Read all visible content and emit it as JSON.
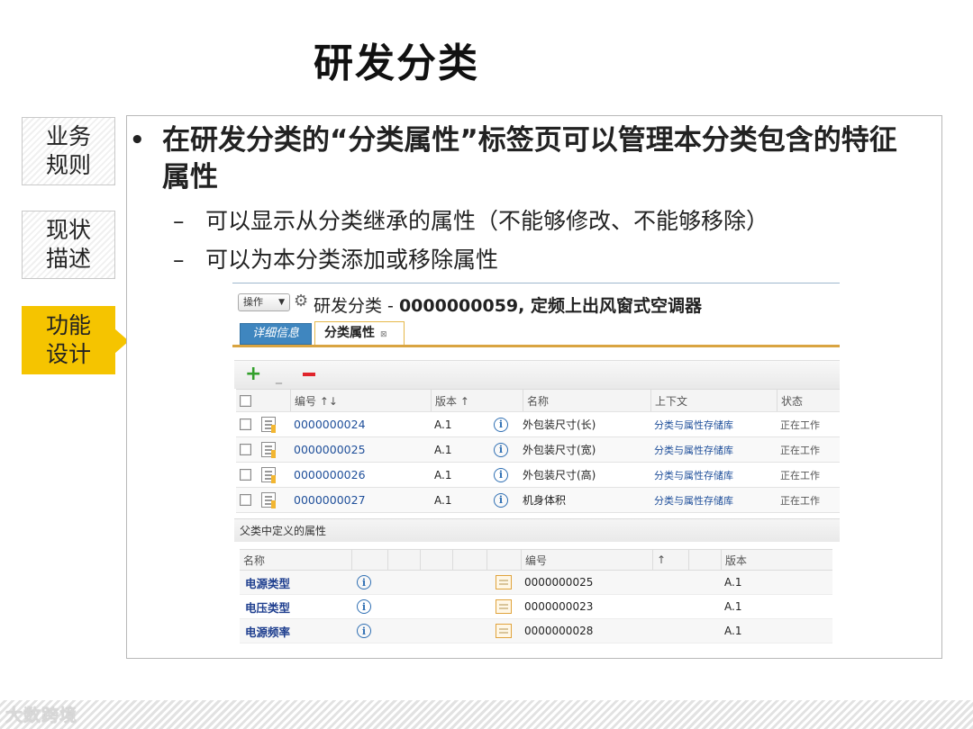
{
  "slide": {
    "title": "研发分类"
  },
  "side_tabs": [
    {
      "line1": "业务",
      "line2": "规则",
      "active": false
    },
    {
      "line1": "现状",
      "line2": "描述",
      "active": false
    },
    {
      "line1": "功能",
      "line2": "设计",
      "active": true
    }
  ],
  "content": {
    "bullet": "在研发分类的“分类属性”标签页可以管理本分类包含的特征属性",
    "bullet_symbol": "•",
    "sub_bullets": [
      "可以显示从分类继承的属性（不能够修改、不能够移除）",
      "可以为本分类添加或移除属性"
    ],
    "dash": "–"
  },
  "screenshot": {
    "op_button": "操作",
    "title_prefix": "研发分类 - ",
    "title_number": "0000000059",
    "title_suffix": ", 定频上出风窗式空调器",
    "tabs": [
      "详细信息",
      "分类属性"
    ],
    "tab_close": "⊠",
    "toolbar": {
      "add": "+",
      "separator": "_"
    },
    "grid1": {
      "headers": {
        "number": "编号 ↑↓",
        "version": "版本 ↑",
        "name": "名称",
        "context": "上下文",
        "state": "状态"
      },
      "rows": [
        {
          "number": "0000000024",
          "version": "A.1",
          "name": "外包装尺寸(长)",
          "context": "分类与属性存储库",
          "state": "正在工作"
        },
        {
          "number": "0000000025",
          "version": "A.1",
          "name": "外包装尺寸(宽)",
          "context": "分类与属性存储库",
          "state": "正在工作"
        },
        {
          "number": "0000000026",
          "version": "A.1",
          "name": "外包装尺寸(高)",
          "context": "分类与属性存储库",
          "state": "正在工作"
        },
        {
          "number": "0000000027",
          "version": "A.1",
          "name": "机身体积",
          "context": "分类与属性存储库",
          "state": "正在工作"
        }
      ]
    },
    "section2_title": "父类中定义的属性",
    "grid2": {
      "headers": {
        "name": "名称",
        "number": "编号",
        "sort": "↑",
        "version": "版本"
      },
      "rows": [
        {
          "name": "电源类型",
          "number": "0000000025",
          "version": "A.1"
        },
        {
          "name": "电压类型",
          "number": "0000000023",
          "version": "A.1"
        },
        {
          "name": "电源频率",
          "number": "0000000028",
          "version": "A.1"
        }
      ]
    },
    "info_glyph": "i"
  },
  "footer": {
    "logo": "大数跨境"
  },
  "colors": {
    "accent": "#f5c400",
    "tab_blue": "#3f86bf",
    "link": "#1f4f9a",
    "delete_red": "#e0242b",
    "add_green": "#33a02c"
  }
}
